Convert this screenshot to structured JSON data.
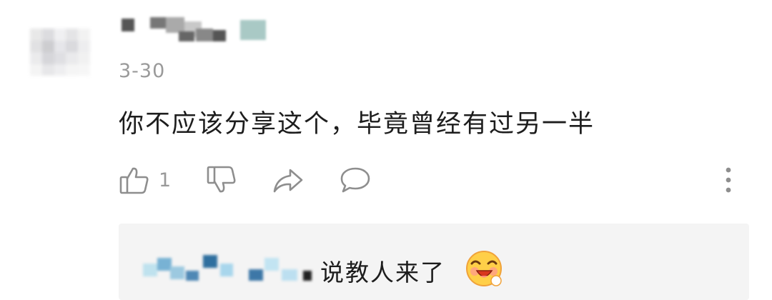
{
  "comment": {
    "date": "3-30",
    "text": "你不应该分享这个，毕竟曾经有过另一半",
    "like_count": "1"
  },
  "actions": {
    "like_icon": "thumbs-up-icon",
    "dislike_icon": "thumbs-down-icon",
    "share_icon": "share-arrow-icon",
    "reply_icon": "comment-bubble-icon",
    "more_icon": "more-vertical-icon"
  },
  "reply": {
    "text": "说教人来了",
    "emoji": "laughing-face-emoji"
  },
  "colors": {
    "text": "#1d1d1d",
    "muted": "#999999",
    "reply_bg": "#f4f4f4"
  }
}
